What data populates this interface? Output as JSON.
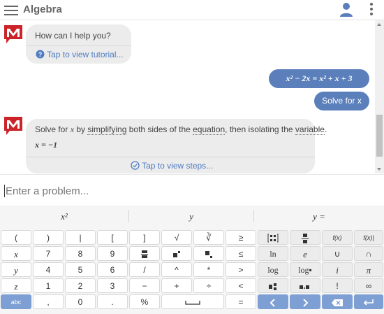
{
  "header": {
    "title": "Algebra",
    "menu_icon": "hamburger-icon",
    "user_icon": "user-icon",
    "more_icon": "more-vertical-icon"
  },
  "chat": {
    "greeting": {
      "text": "How can I help you?",
      "link": "Tap to view tutorial..."
    },
    "user_query": {
      "expression": "x² − 2x = x² + x + 3",
      "action": "Solve for x"
    },
    "answer": {
      "text_before": "Solve for ",
      "var": "x",
      "text_by": " by ",
      "w_simplifying": "simplifying",
      "text_mid1": " both sides of the ",
      "w_equation": "equation",
      "text_mid2": ", then isolating the ",
      "w_variable": "variable",
      "text_end": ".",
      "result": "x = −1",
      "steps_link": "Tap to view steps..."
    }
  },
  "input": {
    "placeholder": "Enter a problem..."
  },
  "keyboard": {
    "tabs": [
      "x²",
      "y",
      "y ="
    ],
    "rows": [
      [
        "(",
        ")",
        "|",
        "[",
        "]",
        "√",
        "∛",
        "≥"
      ],
      [
        "x",
        "7",
        "8",
        "9",
        "▀",
        "▪ᐧ",
        "▪.",
        "≤"
      ],
      [
        "y",
        "4",
        "5",
        "6",
        "/",
        "^",
        "*",
        ">"
      ],
      [
        "z",
        "1",
        "2",
        "3",
        "−",
        "+",
        "÷",
        "<"
      ],
      [
        "abc",
        ",",
        "0",
        ".",
        "%",
        "␣",
        "="
      ]
    ],
    "right_rows": [
      [
        "matrix",
        "limit",
        "f(x)",
        "f(x)|"
      ],
      [
        "ln",
        "e",
        "∪",
        "∩"
      ],
      [
        "log",
        "log▪",
        "i",
        "π"
      ],
      [
        "▪▪",
        "▪▪▪",
        "!",
        "∞"
      ]
    ],
    "nav": [
      "left",
      "right",
      "backspace",
      "enter"
    ]
  },
  "colors": {
    "accent": "#5b7fbb",
    "keyboard_blue": "#7d9fd4",
    "link": "#4f7cc1"
  }
}
